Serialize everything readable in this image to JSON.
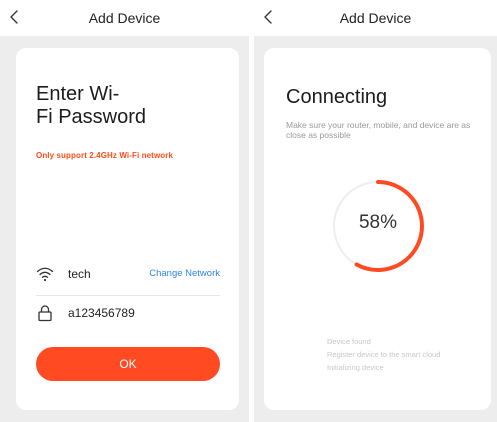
{
  "colors": {
    "accent": "#ff4a22",
    "link": "#2e86e8",
    "warning": "#ff4d1a",
    "track": "#eeeeee"
  },
  "left": {
    "nav_title": "Add Device",
    "title_line1": "Enter Wi-",
    "title_line2": "Fi Password",
    "warning": "Only support 2.4GHz Wi-Fi network",
    "wifi": {
      "icon": "wifi-icon",
      "ssid": "tech",
      "change_label": "Change Network"
    },
    "password": {
      "icon": "lock-icon",
      "value": "a123456789"
    },
    "ok_label": "OK"
  },
  "right": {
    "nav_title": "Add Device",
    "title": "Connecting",
    "subtitle": "Make sure your router, mobile, and device are as close as possible",
    "progress": {
      "value": 58,
      "label": "58%"
    },
    "steps": [
      "Device found",
      "Register device to the smart cloud",
      "Initializing device"
    ]
  }
}
